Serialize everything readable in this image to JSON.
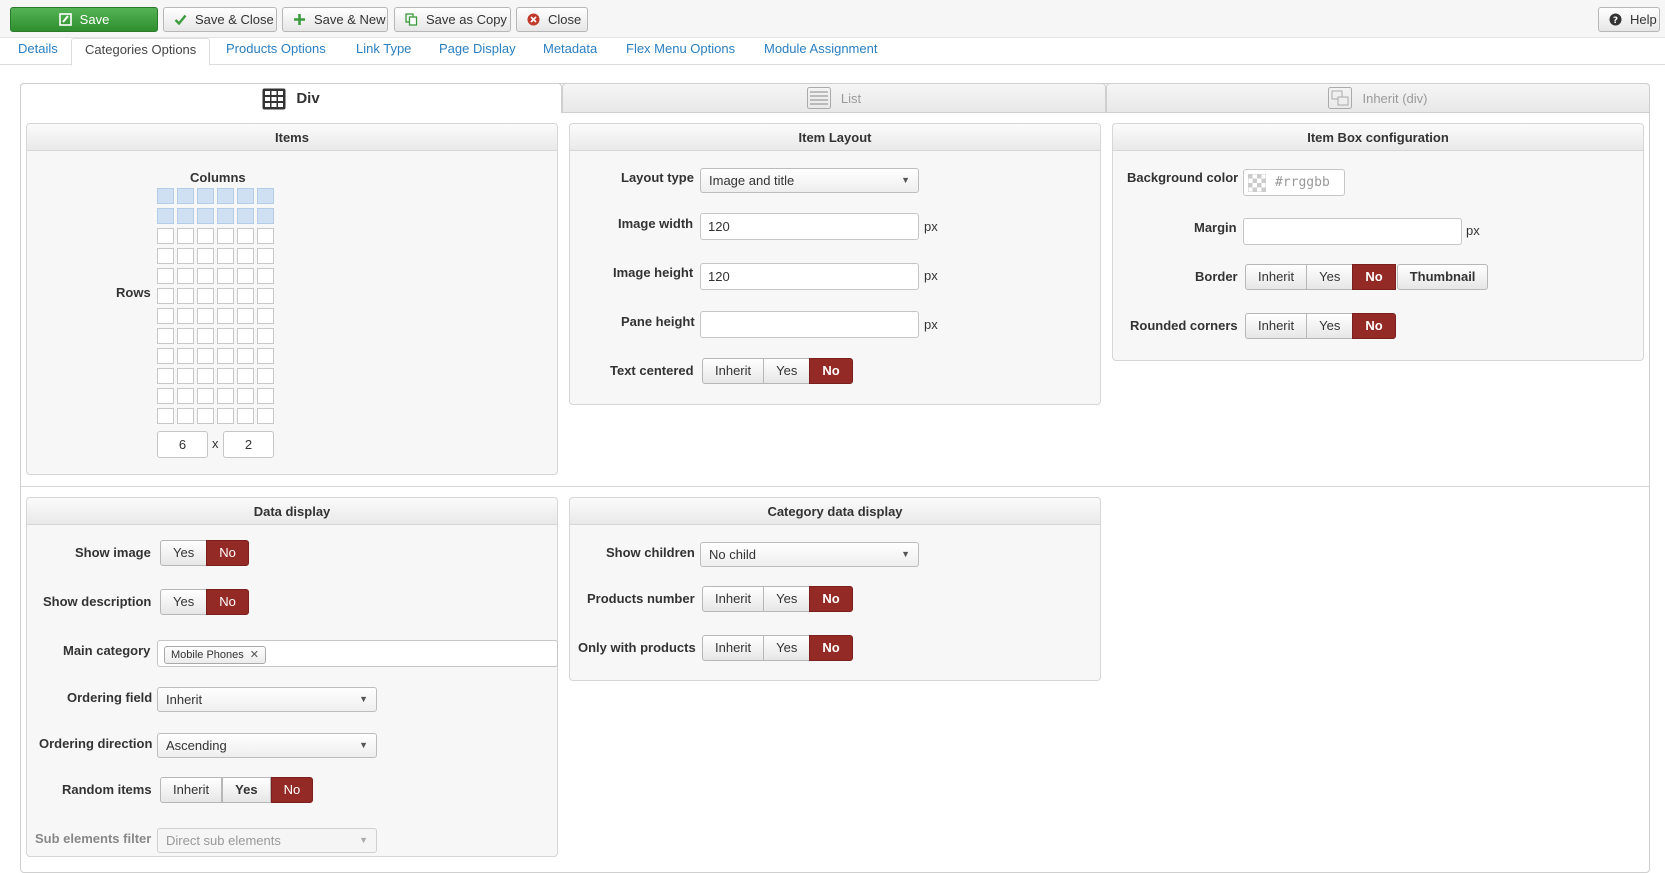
{
  "toolbar": {
    "save": "Save",
    "save_close": "Save & Close",
    "save_new": "Save & New",
    "save_copy": "Save as Copy",
    "close": "Close",
    "help": "Help"
  },
  "tabs": [
    "Details",
    "Categories Options",
    "Products Options",
    "Link Type",
    "Page Display",
    "Metadata",
    "Flex Menu Options",
    "Module Assignment"
  ],
  "layouts": {
    "div": "Div",
    "list": "List",
    "inherit": "Inherit (div)"
  },
  "items_panel": {
    "title": "Items",
    "columns_label": "Columns",
    "rows_label": "Rows",
    "columns_value": "6",
    "times": "x",
    "rows_value": "2"
  },
  "item_layout": {
    "title": "Item Layout",
    "layout_type_label": "Layout type",
    "layout_type_value": "Image and title",
    "image_width_label": "Image width",
    "image_width_value": "120",
    "image_height_label": "Image height",
    "image_height_value": "120",
    "pane_height_label": "Pane height",
    "pane_height_value": "",
    "unit": "px",
    "text_centered_label": "Text centered",
    "text_centered_options": [
      "Inherit",
      "Yes",
      "No"
    ]
  },
  "item_box": {
    "title": "Item Box configuration",
    "bg_color_label": "Background color",
    "bg_color_placeholder": "#rrggbb",
    "margin_label": "Margin",
    "unit": "px",
    "border_label": "Border",
    "border_options": [
      "Inherit",
      "Yes",
      "No",
      "Thumbnail"
    ],
    "rounded_label": "Rounded corners",
    "rounded_options": [
      "Inherit",
      "Yes",
      "No"
    ]
  },
  "data_display": {
    "title": "Data display",
    "show_image_label": "Show image",
    "show_image_options": [
      "Yes",
      "No"
    ],
    "show_desc_label": "Show description",
    "show_desc_options": [
      "Yes",
      "No"
    ],
    "main_category_label": "Main category",
    "main_category_tag": "Mobile Phones",
    "ordering_field_label": "Ordering field",
    "ordering_field_value": "Inherit",
    "ordering_dir_label": "Ordering direction",
    "ordering_dir_value": "Ascending",
    "random_label": "Random items",
    "random_options": [
      "Inherit",
      "Yes",
      "No"
    ],
    "sub_filter_label": "Sub elements filter",
    "sub_filter_value": "Direct sub elements"
  },
  "category_display": {
    "title": "Category data display",
    "show_children_label": "Show children",
    "show_children_value": "No child",
    "products_number_label": "Products number",
    "products_number_options": [
      "Inherit",
      "Yes",
      "No"
    ],
    "only_products_label": "Only with products",
    "only_products_options": [
      "Inherit",
      "Yes",
      "No"
    ]
  },
  "colors": {
    "accent": "#2a7fc1",
    "selected": "#942a25",
    "save": "#3c9b3c",
    "grid_highlight": "#cfe0f3"
  }
}
